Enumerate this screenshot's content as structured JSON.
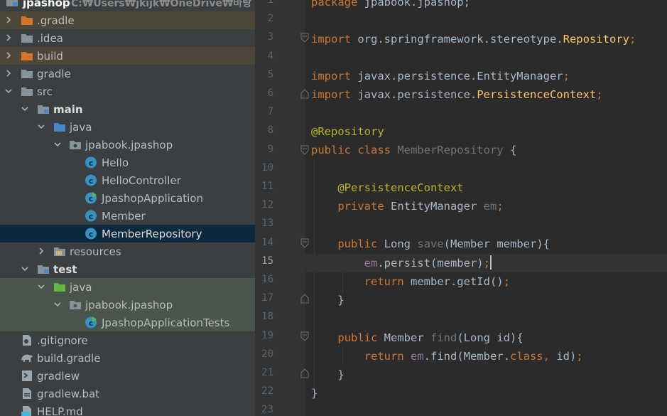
{
  "project_tree": {
    "root": {
      "label": "jpashop",
      "path": "C:₩Users₩jkijk₩OneDrive₩바탕 화면₩"
    },
    "items": [
      {
        "label": ".gradle",
        "icon": "folder-orange-icon"
      },
      {
        "label": ".idea",
        "icon": "folder-icon"
      },
      {
        "label": "build",
        "icon": "folder-orange-icon"
      },
      {
        "label": "gradle",
        "icon": "folder-icon"
      },
      {
        "label": "src",
        "icon": "folder-icon"
      },
      {
        "label": "main",
        "icon": "module-folder-icon"
      },
      {
        "label": "java",
        "icon": "source-folder-icon"
      },
      {
        "label": "jpabook.jpashop",
        "icon": "package-icon"
      },
      {
        "label": "Hello",
        "icon": "class-icon"
      },
      {
        "label": "HelloController",
        "icon": "class-icon"
      },
      {
        "label": "JpashopApplication",
        "icon": "spring-class-icon"
      },
      {
        "label": "Member",
        "icon": "class-icon"
      },
      {
        "label": "MemberRepository",
        "icon": "class-icon"
      },
      {
        "label": "resources",
        "icon": "resources-folder-icon"
      },
      {
        "label": "test",
        "icon": "module-folder-icon"
      },
      {
        "label": "java",
        "icon": "test-folder-icon"
      },
      {
        "label": "jpabook.jpashop",
        "icon": "package-icon"
      },
      {
        "label": "JpashopApplicationTests",
        "icon": "spring-class-icon"
      },
      {
        "label": ".gitignore",
        "icon": "gitignore-icon"
      },
      {
        "label": "build.gradle",
        "icon": "gradle-icon"
      },
      {
        "label": "gradlew",
        "icon": "terminal-icon"
      },
      {
        "label": "gradlew.bat",
        "icon": "file-icon"
      },
      {
        "label": "HELP.md",
        "icon": "markdown-icon"
      }
    ]
  },
  "editor": {
    "current_line": 15,
    "line_numbers": [
      "1",
      "2",
      "3",
      "4",
      "5",
      "6",
      "7",
      "8",
      "9",
      "10",
      "11",
      "12",
      "13",
      "14",
      "15",
      "16",
      "17",
      "18",
      "19",
      "20",
      "21",
      "22",
      "23"
    ],
    "code": {
      "l1_kw": "package",
      "l1_rest": " jpabook.jpashop;",
      "l3_kw": "import",
      "l3_rest": " org.springframework.stereotype.",
      "l3_cls": "Repository",
      "l3_end": ";",
      "l5_kw": "import",
      "l5_rest": " javax.persistence.EntityManager",
      "l5_end": ";",
      "l6_kw": "import",
      "l6_rest": " javax.persistence.",
      "l6_cls": "PersistenceContext",
      "l6_end": ";",
      "l8_ann": "@Repository",
      "l9_kw": "public class",
      "l9_name": " MemberRepository",
      "l9_rest": " {",
      "l11_ann": "@PersistenceContext",
      "l12_kw": "private",
      "l12_type": " EntityManager",
      "l12_field": " em",
      "l12_end": ";",
      "l14_kw": "public",
      "l14_type": " Long",
      "l14_fn": " save",
      "l14_rest": "(Member member){",
      "l15_field": "em",
      "l15_rest": ".persist(member)",
      "l15_end": ";",
      "l16_kw": "return",
      "l16_rest": " member.getId()",
      "l16_end": ";",
      "l17": "}",
      "l19_kw": "public",
      "l19_type": " Member",
      "l19_fn": " find",
      "l19_rest": "(Long id){",
      "l20_kw": "return",
      "l20_field": " em",
      "l20_rest": ".find(Member.",
      "l20_kw2": "class",
      "l20_comma": ",",
      "l20_end": " id)",
      "l20_semi": ";",
      "l21": "}",
      "l22": "}"
    }
  },
  "colors": {
    "tree_bg": "#3c3f41",
    "excluded_bg": "#4e4639",
    "test_bg": "#49544a",
    "selected_bg": "#0d293e",
    "editor_bg": "#2b2b2b",
    "keyword": "#cc7832",
    "annotation": "#bbb529",
    "field": "#9876aa",
    "function": "#ffc66d"
  }
}
